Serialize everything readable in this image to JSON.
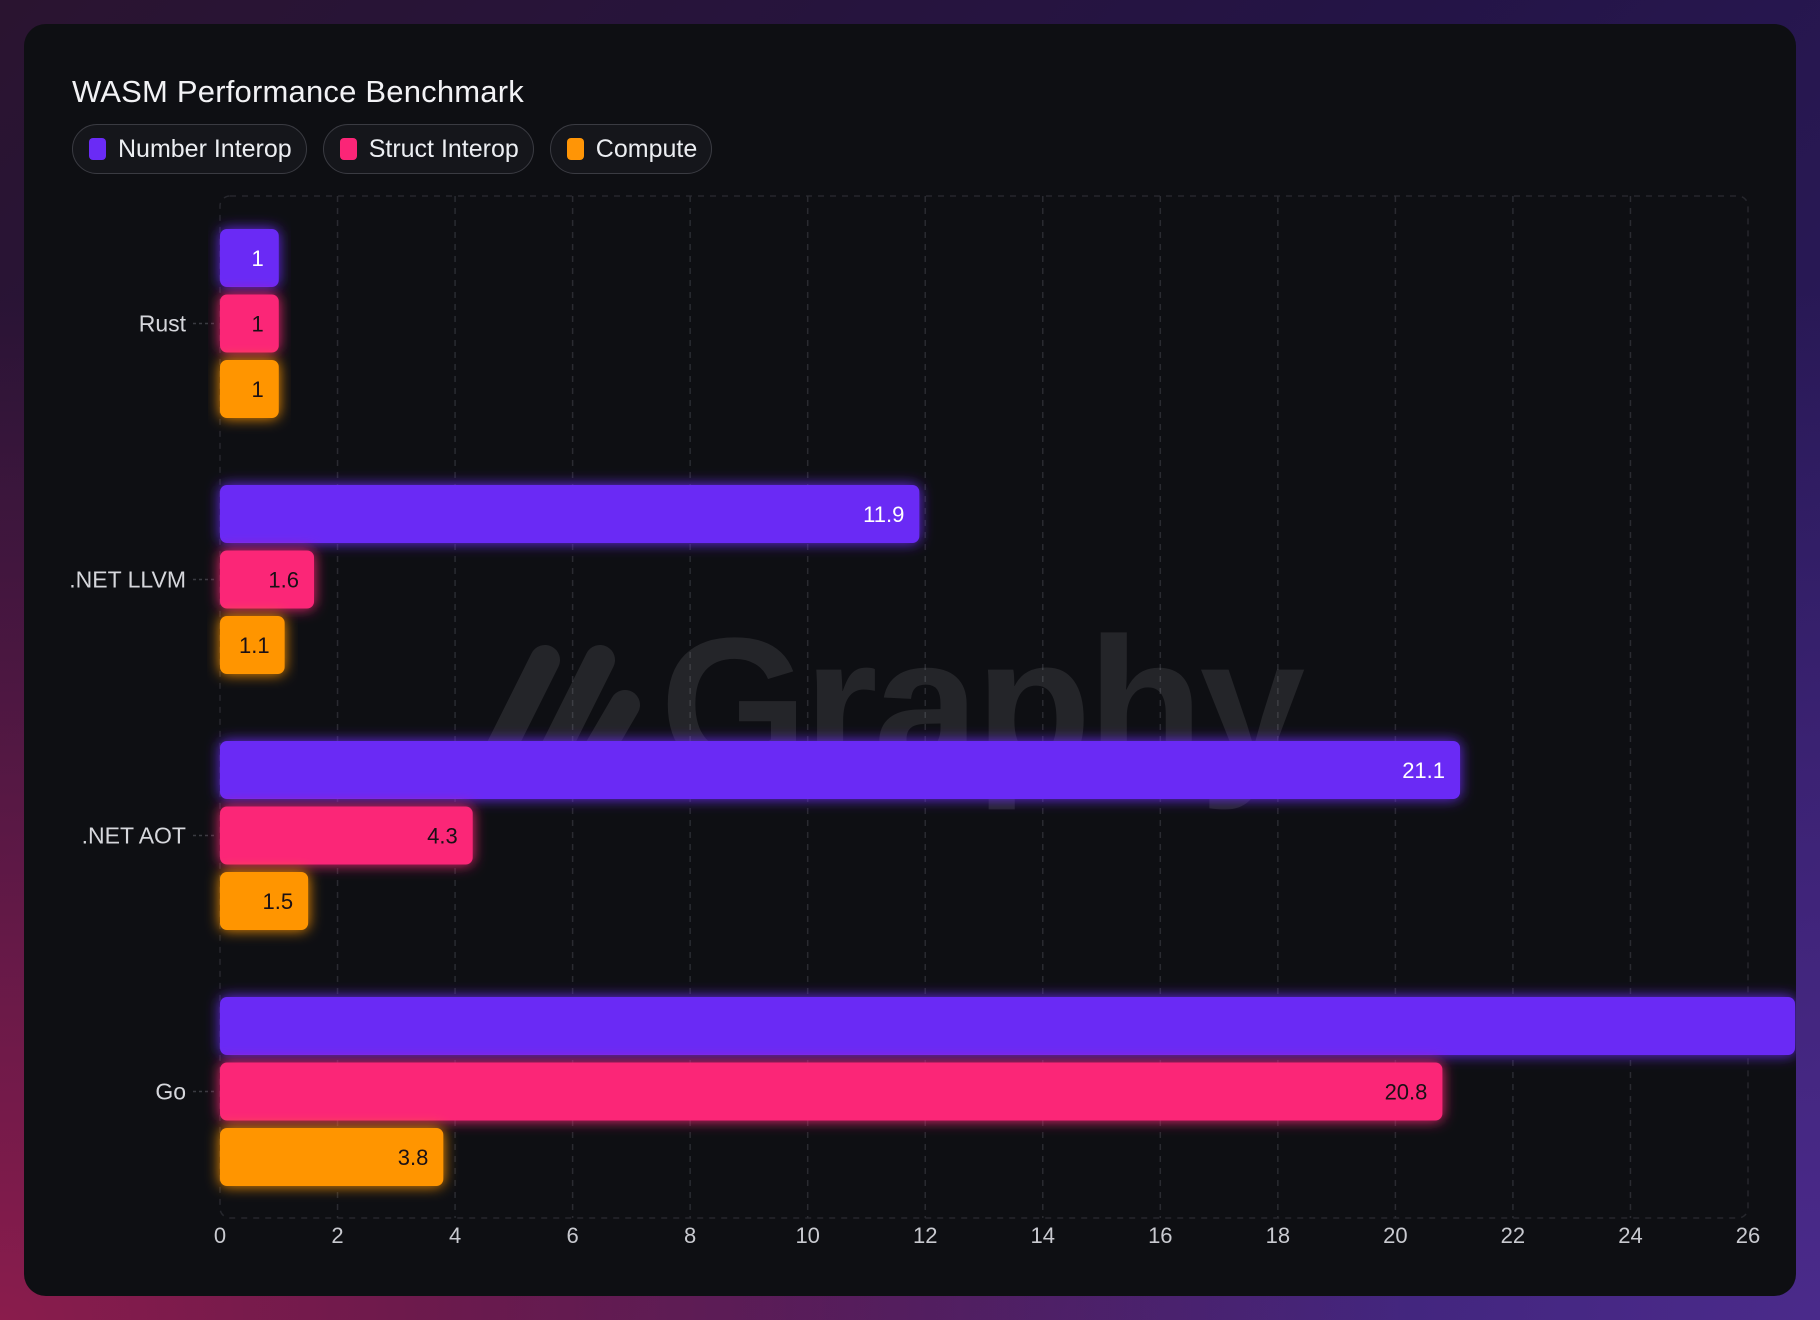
{
  "chart_data": {
    "type": "bar",
    "orientation": "horizontal",
    "title": "WASM Performance Benchmark",
    "categories": [
      "Rust",
      ".NET LLVM",
      ".NET AOT",
      "Go"
    ],
    "series": [
      {
        "name": "Number Interop",
        "color": "#6a2bf5",
        "values": [
          1,
          11.9,
          21.1,
          26.8
        ]
      },
      {
        "name": "Struct Interop",
        "color": "#fb2577",
        "values": [
          1,
          1.6,
          4.3,
          20.8
        ]
      },
      {
        "name": "Compute",
        "color": "#ff9506",
        "values": [
          1,
          1.1,
          1.5,
          3.8
        ]
      }
    ],
    "data_labels": [
      [
        "1",
        "11.9",
        "21.1",
        ""
      ],
      [
        "1",
        "1.6",
        "4.3",
        "20.8"
      ],
      [
        "1",
        "1.1",
        "1.5",
        "3.8"
      ]
    ],
    "x_ticks": [
      "0",
      "2",
      "4",
      "6",
      "8",
      "10",
      "12",
      "14",
      "16",
      "18",
      "20",
      "22",
      "24",
      "26"
    ],
    "xlim": [
      0,
      26
    ],
    "grid": true,
    "legend_position": "top-left",
    "watermark": "Graphy"
  }
}
